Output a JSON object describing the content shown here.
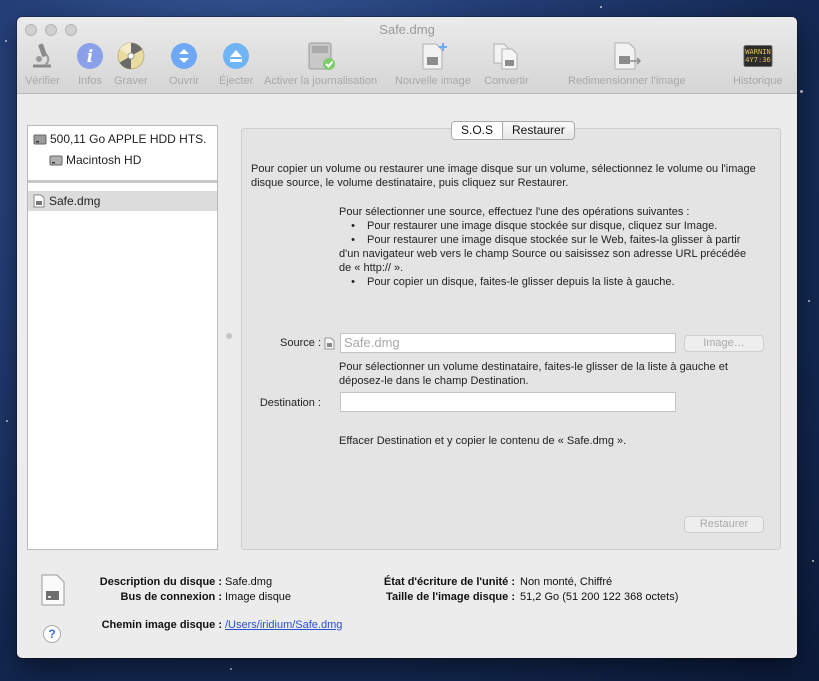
{
  "window": {
    "title": "Safe.dmg"
  },
  "toolbar": {
    "items": [
      {
        "label": "Vérifier",
        "icon": "microscope-icon"
      },
      {
        "label": "Infos",
        "icon": "info-icon"
      },
      {
        "label": "Graver",
        "icon": "burn-icon"
      },
      {
        "label": "Ouvrir",
        "icon": "mount-icon"
      },
      {
        "label": "Éjecter",
        "icon": "eject-icon"
      },
      {
        "label": "Activer la journalisation",
        "icon": "enable-journaling-icon"
      },
      {
        "label": "Nouvelle image",
        "icon": "new-image-icon"
      },
      {
        "label": "Convertir",
        "icon": "convert-icon"
      },
      {
        "label": "Redimensionner l'image",
        "icon": "resize-image-icon"
      },
      {
        "label": "Historique",
        "icon": "log-icon",
        "log_text_1": "WARNIN",
        "log_text_2": "4Y7:36"
      }
    ]
  },
  "sidebar": {
    "items": [
      {
        "label": "500,11 Go APPLE HDD HTS.",
        "icon": "hard-disk-icon",
        "selected": false
      },
      {
        "label": "Macintosh HD",
        "icon": "volume-icon",
        "selected": false
      },
      {
        "label": "Safe.dmg",
        "icon": "disk-image-icon",
        "selected": true
      }
    ]
  },
  "tabs": [
    {
      "label": "S.O.S",
      "active": true
    },
    {
      "label": "Restaurer",
      "active": false
    }
  ],
  "restore": {
    "intro": "Pour copier un volume ou restaurer une image disque sur un volume, sélectionnez le volume ou l'image disque source, le volume destinataire, puis cliquez sur Restaurer.",
    "source_intro": "Pour sélectionner une source, effectuez l'une des opérations suivantes :",
    "bullets": [
      "Pour restaurer une image disque stockée sur disque, cliquez sur Image.",
      "Pour restaurer une image disque stockée sur le Web, faites-la glisser à partir d'un navigateur web vers le champ Source ou saisissez son adresse URL précédée de « http:// ».",
      "Pour copier un disque, faites-le glisser depuis la liste à gauche."
    ],
    "source_label": "Source :",
    "source_value": "Safe.dmg",
    "image_button": "Image…",
    "dest_intro": "Pour sélectionner un volume destinataire, faites-le glisser de la liste à gauche et déposez-le dans le champ Destination.",
    "destination_label": "Destination :",
    "destination_value": "",
    "erase_note": "Effacer Destination et y copier le contenu de « Safe.dmg ».",
    "restore_button": "Restaurer"
  },
  "info": {
    "desc_label": "Description du disque :",
    "desc_value": "Safe.dmg",
    "bus_label": "Bus de connexion :",
    "bus_value": "Image disque",
    "path_label": "Chemin image disque :",
    "path_value": "/Users/iridium/Safe.dmg",
    "write_label": "État d'écriture de l'unité :",
    "write_value": "Non monté, Chiffré",
    "size_label": "Taille de l'image disque :",
    "size_value": "51,2 Go (51 200 122 368 octets)"
  },
  "colors": {
    "accent_blue": "#4a8ff0",
    "link": "#2a4fd0"
  }
}
